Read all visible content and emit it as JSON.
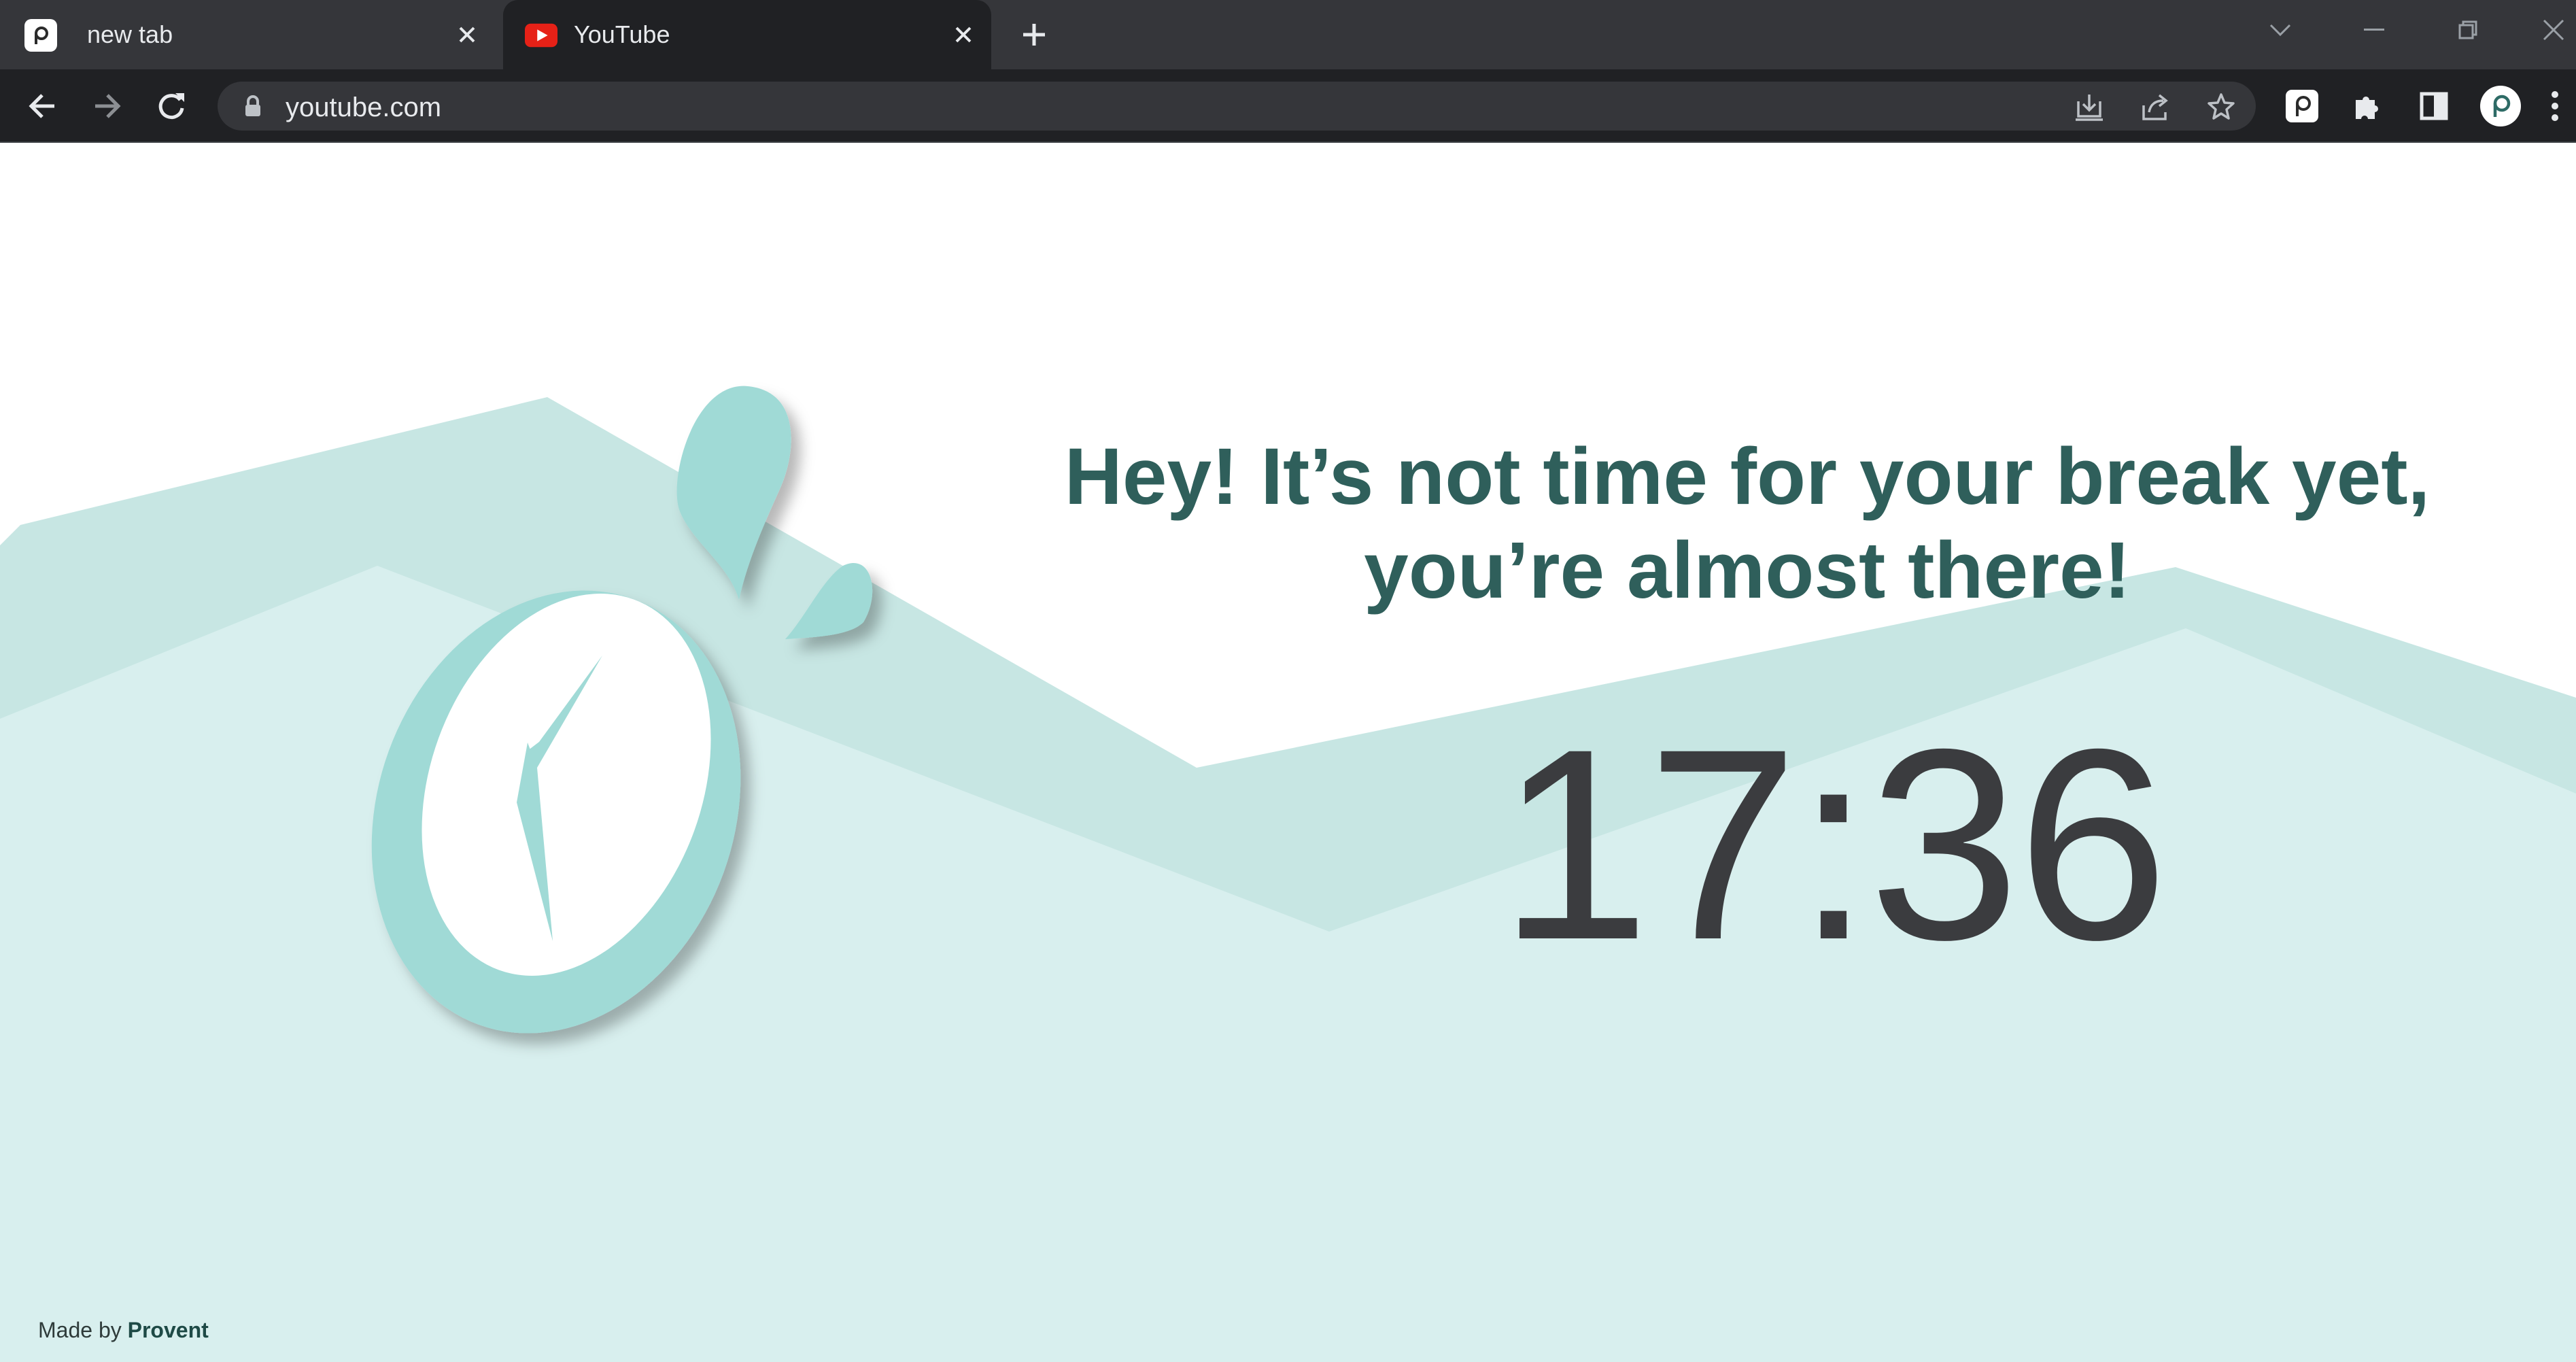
{
  "browser": {
    "tabs": [
      {
        "title": "new tab",
        "favicon": "provent-icon",
        "active": false
      },
      {
        "title": "YouTube",
        "favicon": "youtube-icon",
        "active": true
      }
    ],
    "address_bar": {
      "url": "youtube.com"
    },
    "colors": {
      "tabstrip": "#35363a",
      "toolbar": "#202124",
      "omnibox": "#35363a"
    }
  },
  "page": {
    "headline_line1": "Hey! It’s not time for your break yet,",
    "headline_line2": "you’re almost there!",
    "timer": "17:36",
    "credit_prefix": "Made by",
    "credit_brand": "Provent",
    "colors": {
      "headline": "#2f5f5b",
      "timer": "#3b3c3f",
      "mountain_back": "#c7e6e3",
      "mountain_front": "#d8efee",
      "clock": "#9fd9d5"
    }
  }
}
